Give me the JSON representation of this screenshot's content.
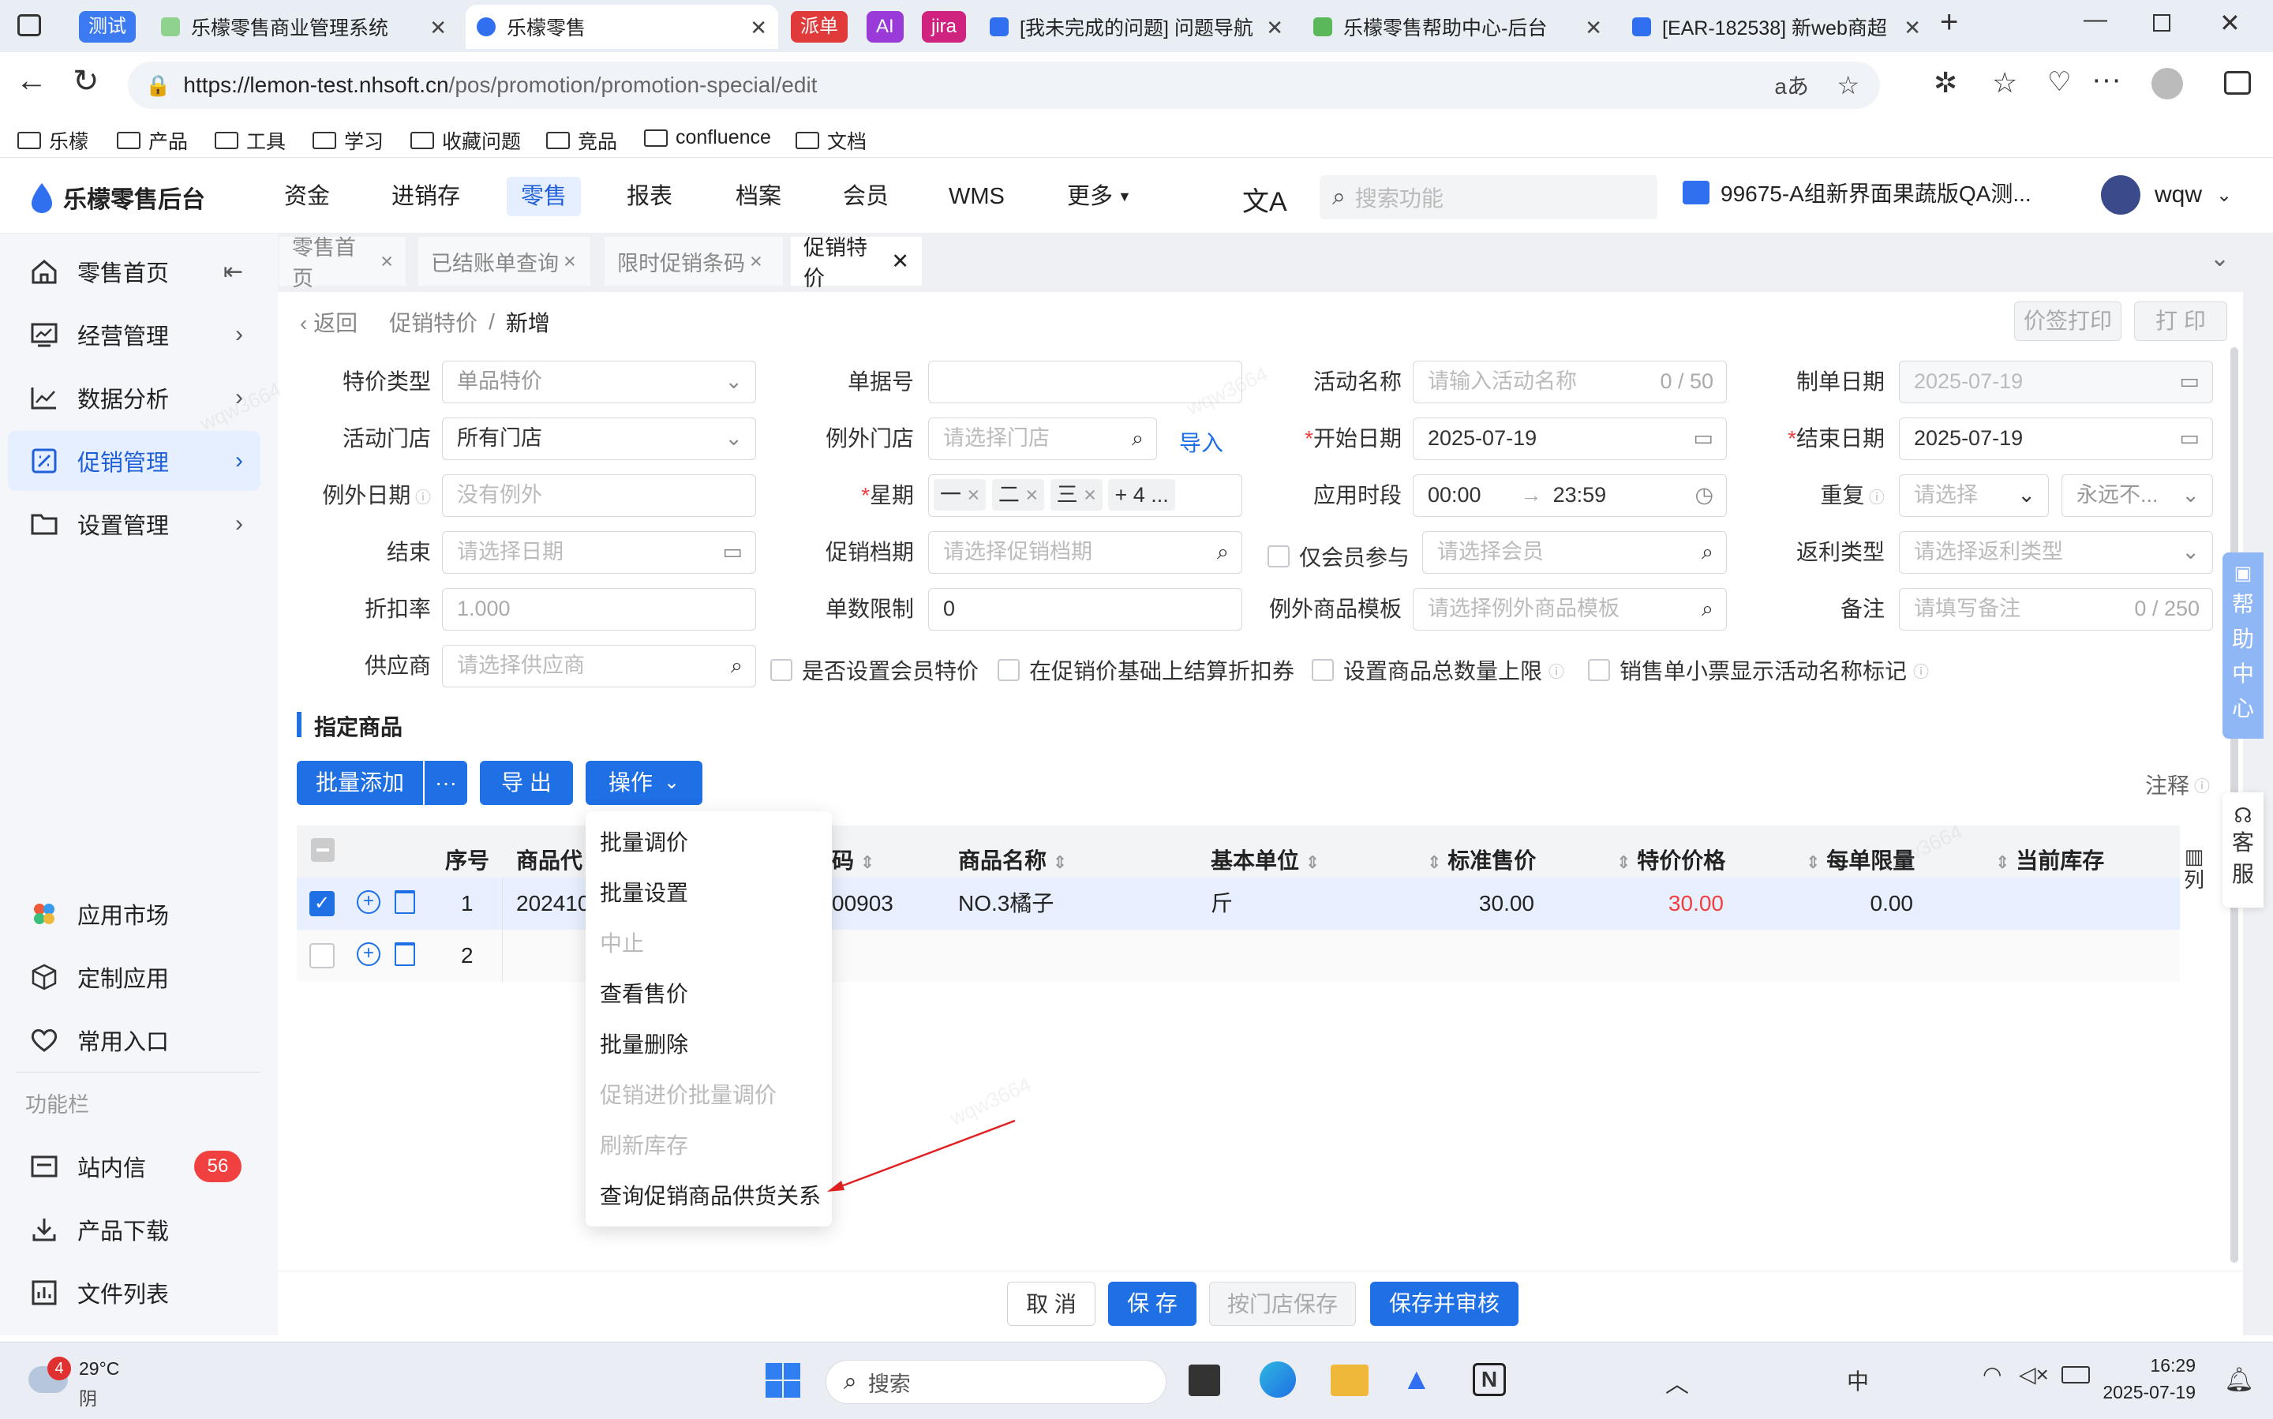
{
  "browser": {
    "tabs": [
      {
        "label": "乐檬零售商业管理系统",
        "pill": "测试",
        "active": false
      },
      {
        "label": "乐檬零售",
        "active": true
      },
      {
        "label": "[我未完成的问题] 问题导航",
        "active": false
      },
      {
        "label": "乐檬零售帮助中心-后台",
        "active": false
      },
      {
        "label": "[EAR-182538] 新web商超",
        "active": false
      }
    ],
    "pills": [
      "派单",
      "AI",
      "jira"
    ],
    "url_host": "https://lemon-test.nhsoft.cn",
    "url_path": "/pos/promotion/promotion-special/edit",
    "bookmarks": [
      "乐檬",
      "产品",
      "工具",
      "学习",
      "收藏问题",
      "竞品",
      "confluence",
      "文档"
    ]
  },
  "header": {
    "brand": "乐檬零售后台",
    "nav": [
      "资金",
      "进销存",
      "零售",
      "报表",
      "档案",
      "会员",
      "WMS",
      "更多"
    ],
    "search_placeholder": "搜索功能",
    "store": "99675-A组新界面果蔬版QA测...",
    "user": "wqw"
  },
  "sidebar": {
    "items": [
      {
        "label": "零售首页"
      },
      {
        "label": "经营管理"
      },
      {
        "label": "数据分析"
      },
      {
        "label": "促销管理"
      },
      {
        "label": "设置管理"
      }
    ],
    "apps": [
      "应用市场",
      "定制应用",
      "常用入口"
    ],
    "section": "功能栏",
    "tools": [
      "站内信",
      "产品下载",
      "文件列表"
    ],
    "badge": "56"
  },
  "pagetabs": [
    "零售首页",
    "已结账单查询",
    "限时促销条码",
    "促销特价"
  ],
  "breadcrumb": {
    "back": "返回",
    "parent": "促销特价",
    "sep": "/",
    "current": "新增"
  },
  "top_buttons": {
    "print_label": "价签打印",
    "print": "打 印"
  },
  "form": {
    "type_label": "特价类型",
    "type_value": "单品特价",
    "bill_label": "单据号",
    "name_label": "活动名称",
    "name_placeholder": "请输入活动名称",
    "name_count": "0 / 50",
    "date_label": "制单日期",
    "date_value": "2025-07-19",
    "store_label": "活动门店",
    "store_value": "所有门店",
    "except_store_label": "例外门店",
    "except_store_placeholder": "请选择门店",
    "import": "导入",
    "start_label": "开始日期",
    "start_value": "2025-07-19",
    "end_label": "结束日期",
    "end_value": "2025-07-19",
    "except_date_label": "例外日期",
    "except_date_placeholder": "没有例外",
    "week_label": "星期",
    "week_tags": [
      "一",
      "二",
      "三"
    ],
    "week_more": "+ 4 ...",
    "period_label": "应用时段",
    "period_start": "00:00",
    "period_arrow": "→",
    "period_end": "23:59",
    "repeat_label": "重复",
    "repeat_placeholder": "请选择",
    "repeat_forever": "永远不...",
    "finish_label": "结束",
    "finish_placeholder": "请选择日期",
    "archive_label": "促销档期",
    "archive_placeholder": "请选择促销档期",
    "member_only": "仅会员参与",
    "member_placeholder": "请选择会员",
    "rebate_label": "返利类型",
    "rebate_placeholder": "请选择返利类型",
    "discount_label": "折扣率",
    "discount_value": "1.000",
    "limit_label": "单数限制",
    "limit_value": "0",
    "except_tpl_label": "例外商品模板",
    "except_tpl_placeholder": "请选择例外商品模板",
    "remark_label": "备注",
    "remark_placeholder": "请填写备注",
    "remark_count": "0 / 250",
    "supplier_label": "供应商",
    "supplier_placeholder": "请选择供应商",
    "cb1": "是否设置会员特价",
    "cb2": "在促销价基础上结算折扣券",
    "cb3": "设置商品总数量上限",
    "cb4": "销售单小票显示活动名称标记"
  },
  "section_title": "指定商品",
  "toolbar": {
    "batch_add": "批量添加",
    "more": "···",
    "export": "导 出",
    "operate": "操作",
    "note": "注释"
  },
  "table": {
    "headers": [
      "序号",
      "商品代",
      "码",
      "商品名称",
      "基本单位",
      "标准售价",
      "特价价格",
      "每单限量",
      "当前库存"
    ],
    "columns_btn": "列",
    "rows": [
      {
        "seq": "1",
        "code": "202410",
        "barcode": "00903",
        "name": "NO.3橘子",
        "unit": "斤",
        "std": "30.00",
        "special": "30.00",
        "limit": "0.00"
      },
      {
        "seq": "2"
      }
    ]
  },
  "dropdown": [
    {
      "label": "批量调价",
      "disabled": false
    },
    {
      "label": "批量设置",
      "disabled": false
    },
    {
      "label": "中止",
      "disabled": true
    },
    {
      "label": "查看售价",
      "disabled": false
    },
    {
      "label": "批量删除",
      "disabled": false
    },
    {
      "label": "促销进价批量调价",
      "disabled": true
    },
    {
      "label": "刷新库存",
      "disabled": true
    },
    {
      "label": "查询促销商品供货关系",
      "disabled": false
    }
  ],
  "footer": {
    "cancel": "取 消",
    "save": "保 存",
    "save_store": "按门店保存",
    "save_audit": "保存并审核"
  },
  "float": {
    "help": [
      "帮",
      "助",
      "中",
      "心"
    ],
    "service": [
      "客",
      "服"
    ]
  },
  "taskbar": {
    "temp": "29°C",
    "weather": "阴",
    "weather_badge": "4",
    "search": "搜索",
    "time": "16:29",
    "date": "2025-07-19",
    "lang": "中"
  },
  "watermark": "wqw3664",
  "colors": {
    "primary": "#1f6fe5",
    "danger": "#f04040",
    "selected_row": "#e8f0ff"
  }
}
